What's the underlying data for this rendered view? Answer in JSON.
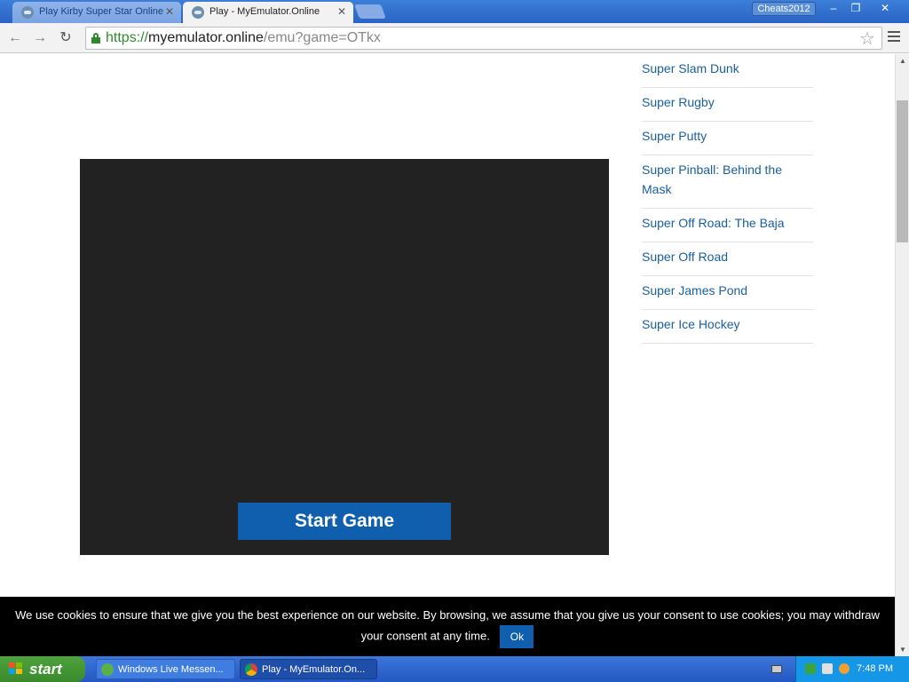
{
  "browser": {
    "tabs": [
      {
        "label": "Play Kirby Super Star Online",
        "active": false
      },
      {
        "label": "Play - MyEmulator.Online",
        "active": true
      }
    ],
    "tab_close_glyph": "✕",
    "profile_name": "Cheats2012",
    "window_controls": {
      "minimize": "–",
      "restore": "❐",
      "close": "✕"
    },
    "url": {
      "scheme": "https://",
      "host": "myemulator.online",
      "path": "/emu?game=OTkx"
    },
    "icons": {
      "back": "back-arrow-icon",
      "forward": "forward-arrow-icon",
      "reload": "reload-icon",
      "lock": "lock-icon",
      "bookmark": "star-icon",
      "menu": "hamburger-menu-icon"
    }
  },
  "page": {
    "start_game_label": "Start Game",
    "game_list": [
      "Super Slam Dunk",
      "Super Rugby",
      "Super Putty",
      "Super Pinball: Behind the Mask",
      "Super Off Road: The Baja",
      "Super Off Road",
      "Super James Pond",
      "Super Ice Hockey"
    ],
    "cookie_text": "We use cookies to ensure that we give you the best experience on our website. By browsing, we assume that you give us your consent to use cookies; you may withdraw your consent at any time.",
    "cookie_ok": "Ok",
    "colors": {
      "accent": "#0f5fae",
      "game_bg": "#222222",
      "link": "#1a5f9e"
    }
  },
  "taskbar": {
    "start_label": "start",
    "items": [
      {
        "label": "Windows Live Messen...",
        "active": false
      },
      {
        "label": "Play - MyEmulator.On...",
        "active": true
      }
    ],
    "clock": "7:48 PM"
  }
}
